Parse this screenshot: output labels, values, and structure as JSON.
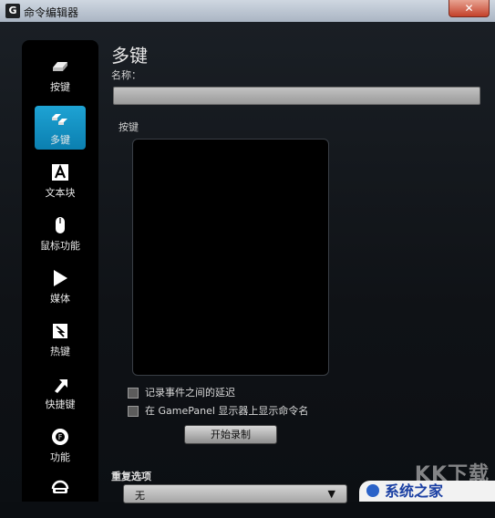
{
  "window": {
    "title": "命令编辑器",
    "close_label": "✕",
    "app_icon": "G"
  },
  "sidebar": {
    "items": [
      {
        "label": "按键",
        "icon": "key-icon"
      },
      {
        "label": "多键",
        "icon": "multikey-icon",
        "active": true
      },
      {
        "label": "文本块",
        "icon": "text-block-icon"
      },
      {
        "label": "鼠标功能",
        "icon": "mouse-icon"
      },
      {
        "label": "媒体",
        "icon": "media-play-icon"
      },
      {
        "label": "热键",
        "icon": "hotkey-icon"
      },
      {
        "label": "快捷键",
        "icon": "shortcut-arrow-icon"
      },
      {
        "label": "功能",
        "icon": "function-gear-icon"
      },
      {
        "label": "",
        "icon": "ventrilo-icon"
      }
    ]
  },
  "main": {
    "heading": "多键",
    "name_label": "名称：",
    "name_value": "",
    "keys_label": "按键",
    "options": [
      {
        "label": "记录事件之间的延迟",
        "checked": false
      },
      {
        "label": "在 GamePanel 显示器上显示命令名",
        "checked": false
      }
    ],
    "record_button": "开始录制",
    "repeat_label": "重复选项",
    "repeat_value": "无"
  },
  "watermark": {
    "top": "KK下载",
    "bottom": "系统之家"
  },
  "colors": {
    "accent": "#1ea3d4",
    "background": "#0b0e12"
  }
}
